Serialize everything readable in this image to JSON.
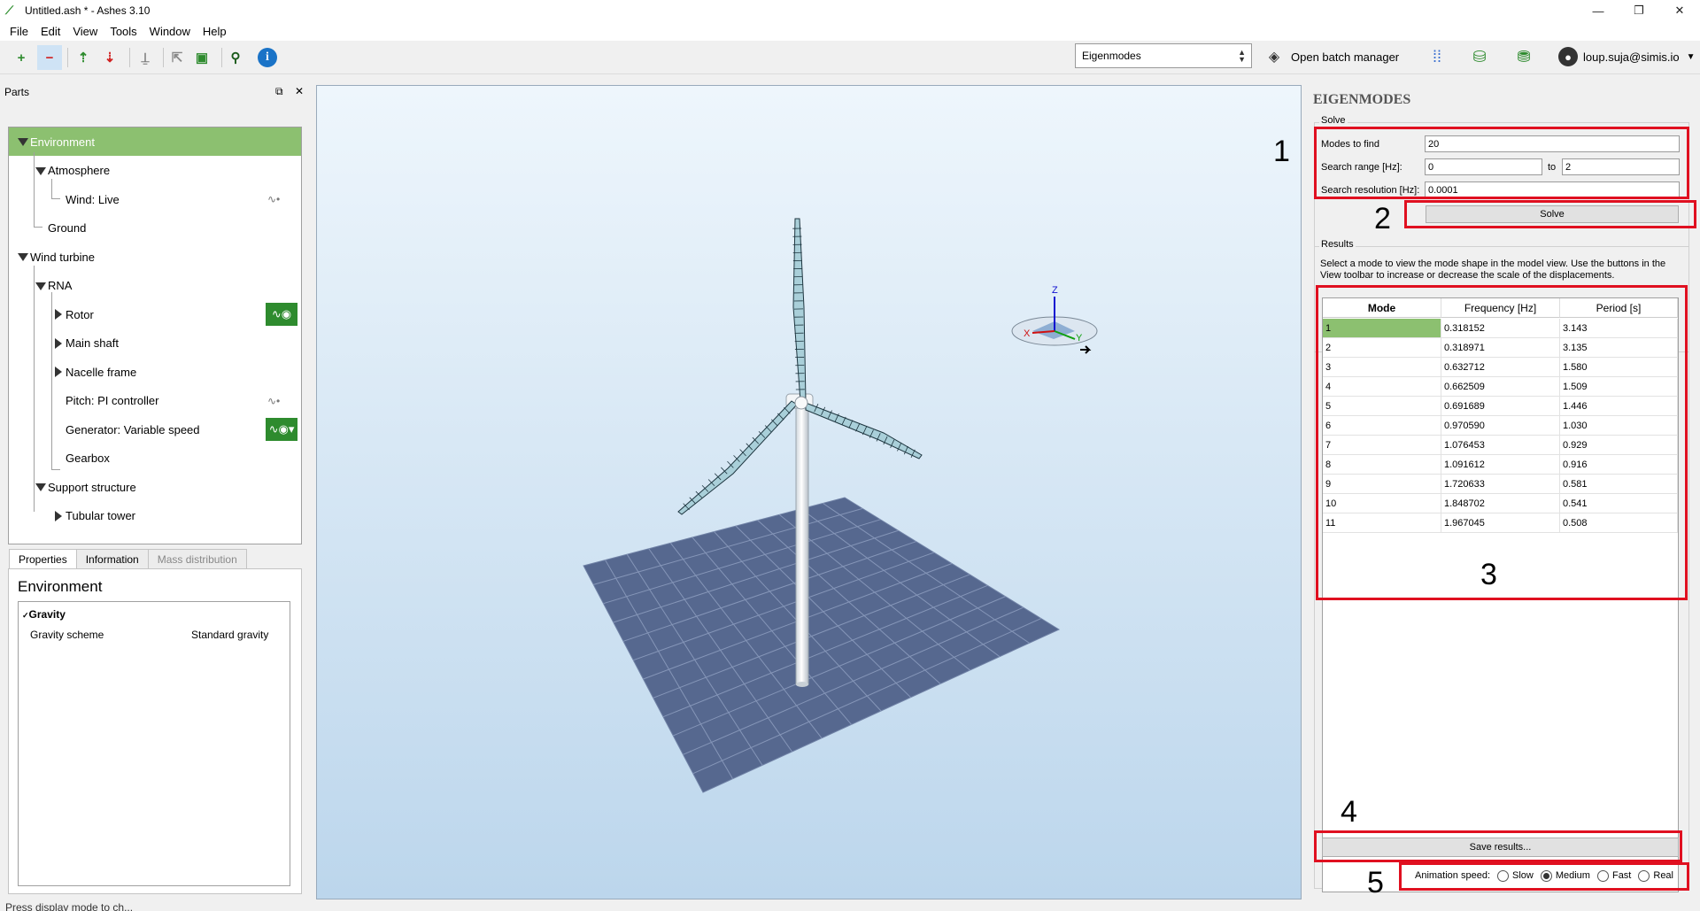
{
  "window": {
    "title": "Untitled.ash * - Ashes 3.10",
    "controls": [
      "—",
      "❐",
      "✕"
    ]
  },
  "menu": [
    "File",
    "Edit",
    "View",
    "Tools",
    "Window",
    "Help"
  ],
  "toolbar": {
    "mode_select": "Eigenmodes",
    "batch_label": "Open batch manager",
    "user": "loup.suja@simis.io"
  },
  "parts": {
    "title": "Parts",
    "tree": [
      {
        "label": "Environment",
        "level": 0,
        "expander": "down",
        "selected": true
      },
      {
        "label": "Atmosphere",
        "level": 1,
        "expander": "down"
      },
      {
        "label": "Wind: Live",
        "level": 2,
        "expander": "none",
        "icon": "wave"
      },
      {
        "label": "Ground",
        "level": 1,
        "expander": "none"
      },
      {
        "label": "Wind turbine",
        "level": 0,
        "expander": "down"
      },
      {
        "label": "RNA",
        "level": 1,
        "expander": "down"
      },
      {
        "label": "Rotor",
        "level": 2,
        "expander": "right",
        "icon": "badge"
      },
      {
        "label": "Main shaft",
        "level": 2,
        "expander": "right"
      },
      {
        "label": "Nacelle frame",
        "level": 2,
        "expander": "right"
      },
      {
        "label": "Pitch: PI controller",
        "level": 2,
        "expander": "none",
        "icon": "wave"
      },
      {
        "label": "Generator: Variable speed",
        "level": 2,
        "expander": "none",
        "icon": "badge-drop"
      },
      {
        "label": "Gearbox",
        "level": 2,
        "expander": "none"
      },
      {
        "label": "Support structure",
        "level": 1,
        "expander": "down"
      },
      {
        "label": "Tubular tower",
        "level": 2,
        "expander": "right"
      }
    ]
  },
  "properties": {
    "tabs": [
      "Properties",
      "Information",
      "Mass distribution"
    ],
    "title": "Environment",
    "section": "Gravity",
    "key": "Gravity scheme",
    "value": "Standard gravity"
  },
  "status": "Press display mode to ch...",
  "axes": {
    "x": "X",
    "y": "Y",
    "z": "Z"
  },
  "eigen": {
    "title": "EIGENMODES",
    "solve_label": "Solve",
    "modes_label": "Modes to find",
    "modes_value": "20",
    "range_label": "Search range [Hz]:",
    "range_from": "0",
    "range_to_label": "to",
    "range_to": "2",
    "res_label": "Search resolution [Hz]:",
    "res_value": "0.0001",
    "solve_button": "Solve",
    "results_label": "Results",
    "results_desc": "Select a mode to view the mode shape in the model view. Use the buttons in the View toolbar to increase or decrease the scale of the displacements.",
    "columns": [
      "Mode",
      "Frequency [Hz]",
      "Period [s]"
    ],
    "rows": [
      [
        "1",
        "0.318152",
        "3.143"
      ],
      [
        "2",
        "0.318971",
        "3.135"
      ],
      [
        "3",
        "0.632712",
        "1.580"
      ],
      [
        "4",
        "0.662509",
        "1.509"
      ],
      [
        "5",
        "0.691689",
        "1.446"
      ],
      [
        "6",
        "0.970590",
        "1.030"
      ],
      [
        "7",
        "1.076453",
        "0.929"
      ],
      [
        "8",
        "1.091612",
        "0.916"
      ],
      [
        "9",
        "1.720633",
        "0.581"
      ],
      [
        "10",
        "1.848702",
        "0.541"
      ],
      [
        "11",
        "1.967045",
        "0.508"
      ]
    ],
    "save_button": "Save results...",
    "anim_label": "Animation speed:",
    "anim_options": [
      "Slow",
      "Medium",
      "Fast",
      "Real"
    ],
    "anim_selected": "Medium"
  },
  "annotations": [
    "1",
    "2",
    "3",
    "4",
    "5"
  ],
  "colors": {
    "accent_green": "#8cc070",
    "badge_green": "#2e8b2e",
    "annotation_red": "#e01020",
    "ground_blue": "#56688f"
  }
}
